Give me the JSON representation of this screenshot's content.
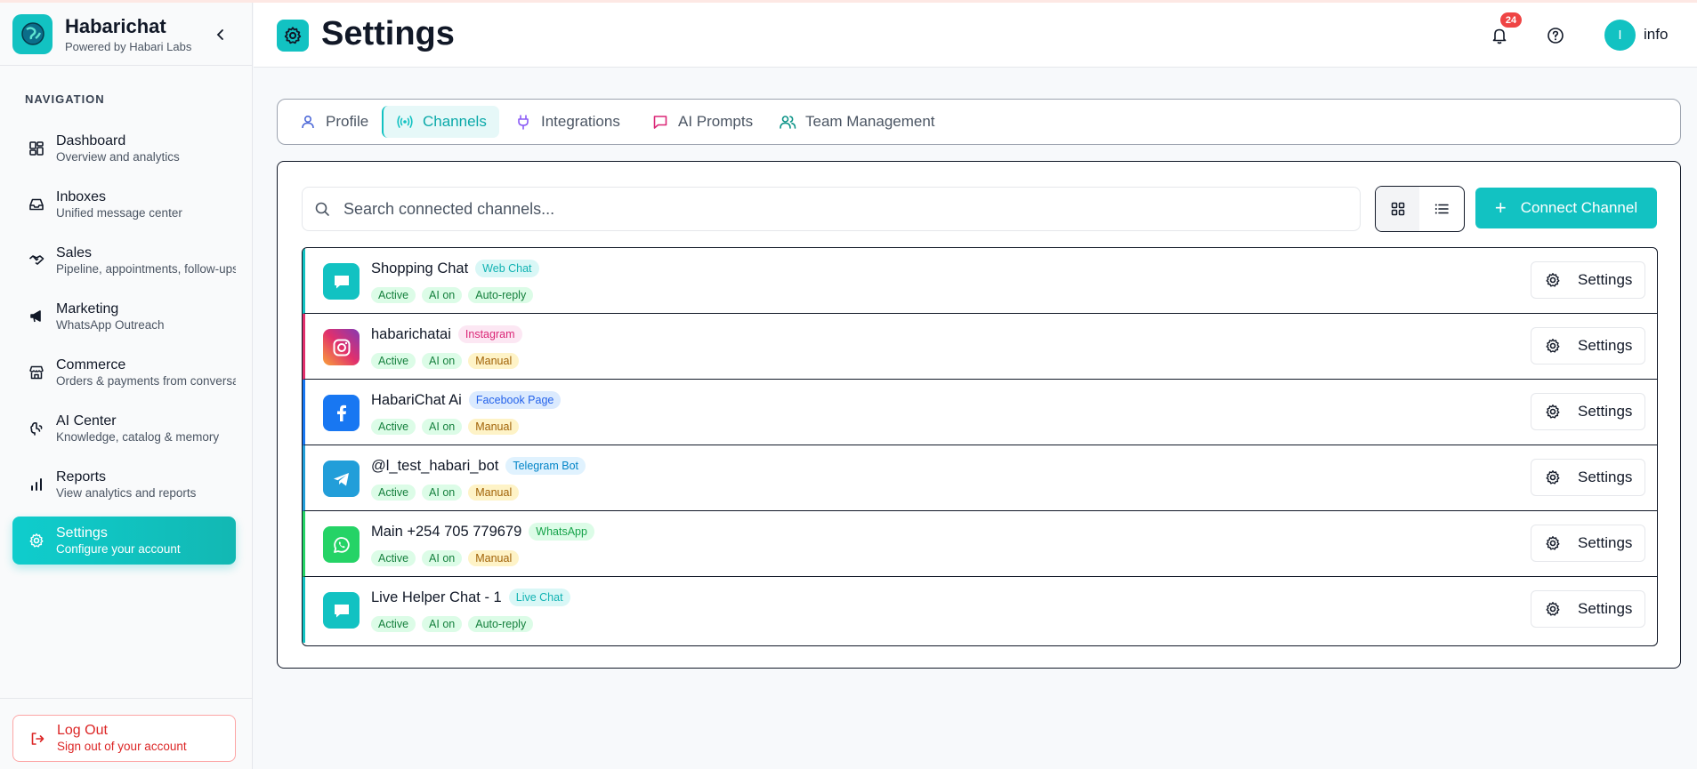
{
  "app": {
    "name": "Habarichat",
    "tagline": "Powered by Habari Labs"
  },
  "sidebar": {
    "heading": "NAVIGATION",
    "items": [
      {
        "label": "Dashboard",
        "desc": "Overview and analytics",
        "icon": "dashboard-icon"
      },
      {
        "label": "Inboxes",
        "desc": "Unified message center",
        "icon": "inbox-icon"
      },
      {
        "label": "Sales",
        "desc": "Pipeline, appointments, follow-ups",
        "icon": "handshake-icon"
      },
      {
        "label": "Marketing",
        "desc": "WhatsApp Outreach",
        "icon": "megaphone-icon"
      },
      {
        "label": "Commerce",
        "desc": "Orders & payments from conversations",
        "icon": "store-icon"
      },
      {
        "label": "AI Center",
        "desc": "Knowledge, catalog & memory",
        "icon": "brain-icon"
      },
      {
        "label": "Reports",
        "desc": "View analytics and reports",
        "icon": "bar-chart-icon"
      },
      {
        "label": "Settings",
        "desc": "Configure your account",
        "icon": "gear-icon"
      }
    ],
    "logout": {
      "label": "Log Out",
      "desc": "Sign out of your account"
    }
  },
  "header": {
    "title": "Settings",
    "notification_count": "24",
    "user_initial": "I",
    "user_name": "info"
  },
  "tabs": [
    {
      "label": "Profile",
      "icon": "user-icon"
    },
    {
      "label": "Channels",
      "icon": "broadcast-icon"
    },
    {
      "label": "Integrations",
      "icon": "plug-icon"
    },
    {
      "label": "AI Prompts",
      "icon": "message-square-icon"
    },
    {
      "label": "Team Management",
      "icon": "users-icon"
    }
  ],
  "active_tab": "Channels",
  "channels_panel": {
    "search_placeholder": "Search connected channels...",
    "connect_label": "Connect Channel",
    "settings_label": "Settings"
  },
  "channels": [
    {
      "name": "Shopping Chat",
      "type": "Web Chat",
      "status": "Active",
      "ai": "AI on",
      "mode": "Auto-reply",
      "icon": "chat-bubble-icon",
      "accent": "#12c2c2"
    },
    {
      "name": "habarichatai",
      "type": "Instagram",
      "status": "Active",
      "ai": "AI on",
      "mode": "Manual",
      "icon": "instagram-icon",
      "accent": "#e1306c"
    },
    {
      "name": "HabariChat Ai",
      "type": "Facebook Page",
      "status": "Active",
      "ai": "AI on",
      "mode": "Manual",
      "icon": "facebook-icon",
      "accent": "#1877f2"
    },
    {
      "name": "@l_test_habari_bot",
      "type": "Telegram Bot",
      "status": "Active",
      "ai": "AI on",
      "mode": "Manual",
      "icon": "telegram-icon",
      "accent": "#229ed9"
    },
    {
      "name": "Main +254 705 779679",
      "type": "WhatsApp",
      "status": "Active",
      "ai": "AI on",
      "mode": "Manual",
      "icon": "whatsapp-icon",
      "accent": "#25d366"
    },
    {
      "name": "Live Helper Chat - 1",
      "type": "Live Chat",
      "status": "Active",
      "ai": "AI on",
      "mode": "Auto-reply",
      "icon": "chat-bubble-icon",
      "accent": "#12c2c2"
    }
  ]
}
